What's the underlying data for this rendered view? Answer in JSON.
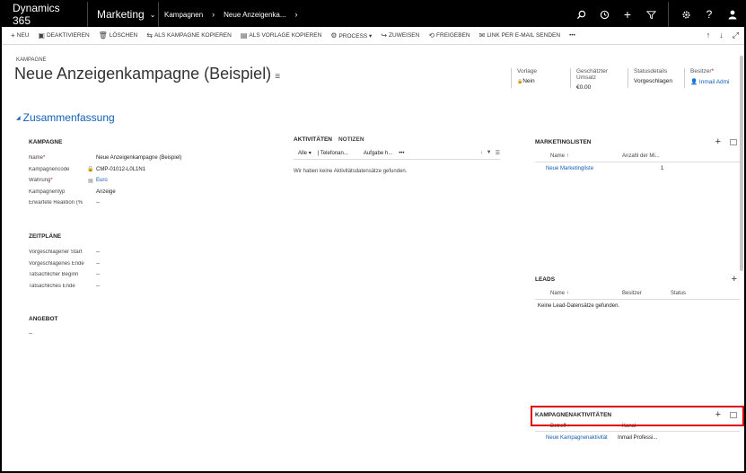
{
  "topnav": {
    "brand": "Dynamics 365",
    "module": "Marketing",
    "breadcrumb": [
      "Kampagnen",
      "Neue Anzeigenka..."
    ],
    "icons": [
      "search-icon",
      "history-icon",
      "plus-icon",
      "filter-icon",
      "gear-icon",
      "help-icon",
      "user-icon"
    ]
  },
  "commands": [
    {
      "icon": "+",
      "label": "NEU"
    },
    {
      "icon": "▣",
      "label": "DEAKTIVIEREN"
    },
    {
      "icon": "🗑",
      "label": "LÖSCHEN"
    },
    {
      "icon": "⇆",
      "label": "ALS KAMPAGNE KOPIEREN"
    },
    {
      "icon": "▤",
      "label": "ALS VORLAGE KOPIEREN"
    },
    {
      "icon": "⚙",
      "label": "PROCESS ▾"
    },
    {
      "icon": "↪",
      "label": "ZUWEISEN"
    },
    {
      "icon": "⟲",
      "label": "FREIGEBEN"
    },
    {
      "icon": "✉",
      "label": "LINK PER E-MAIL SENDEN"
    },
    {
      "icon": "",
      "label": "•••"
    }
  ],
  "header": {
    "entity": "KAMPAGNE",
    "title": "Neue Anzeigenkampagne (Beispiel)",
    "fields": [
      {
        "label": "Vorlage",
        "value": "Nein",
        "required": false,
        "lock": true
      },
      {
        "label": "Geschätzter Umsatz",
        "value": "€0.00",
        "required": false
      },
      {
        "label": "Statusdetails",
        "value": "Vorgeschlagen",
        "required": false
      },
      {
        "label": "Besitzer",
        "value": "Inmail Admi",
        "required": true,
        "link": true
      }
    ]
  },
  "section_title": "Zusammenfassung",
  "kampagne": {
    "title": "KAMPAGNE",
    "rows": [
      {
        "label": "Name",
        "req": "*",
        "lock": "",
        "value": "Neue Anzeigenkampagne (Beispiel)"
      },
      {
        "label": "Kampagnencode",
        "req": "",
        "lock": "🔒",
        "value": "CMP-01012-L0L1N1"
      },
      {
        "label": "Währung",
        "req": "*",
        "lock": "▤",
        "value": "Euro"
      },
      {
        "label": "Kampagnentyp",
        "req": "",
        "lock": "",
        "value": "Anzeige"
      },
      {
        "label": "Erwartete Reaktion (%",
        "req": "",
        "lock": "",
        "value": "--"
      }
    ]
  },
  "zeitplaene": {
    "title": "ZEITPLÄNE",
    "rows": [
      {
        "label": "Vorgeschlagener Start",
        "value": "--"
      },
      {
        "label": "Vorgeschlagenes Ende",
        "value": "--"
      },
      {
        "label": "Tatsächlicher Beginn",
        "value": "--"
      },
      {
        "label": "Tatsächliches Ende",
        "value": "--"
      }
    ]
  },
  "angebot": {
    "title": "ANGEBOT",
    "value": "--"
  },
  "activities": {
    "tab_active": "AKTIVITÄTEN",
    "tab_notes": "NOTIZEN",
    "filter_all": "Alle",
    "filter_phone": "| Telefonan...",
    "filter_task": "Aufgabe h...",
    "more": "•••",
    "empty": "Wir haben keine Aktivitätsdatensätze gefunden."
  },
  "marketinglisten": {
    "title": "MARKETINGLISTEN",
    "col_name": "Name ↑",
    "col_count": "Anzahl der Mi...",
    "rows": [
      {
        "name": "Neue Marketingliste",
        "count": "1"
      }
    ]
  },
  "leads": {
    "title": "LEADS",
    "col_name": "Name ↑",
    "col_owner": "Besitzer",
    "col_status": "Status",
    "empty": "Keine Lead-Datensätze gefunden."
  },
  "kampagnenaktivitaeten": {
    "title": "KAMPAGNENAKTIVITÄTEN",
    "col_betreff": "Betreff ↑",
    "col_kanal": "Kanal",
    "rows": [
      {
        "betreff": "Neue Kampagnenaktivität",
        "kanal": "Inmail Professi..."
      }
    ]
  }
}
